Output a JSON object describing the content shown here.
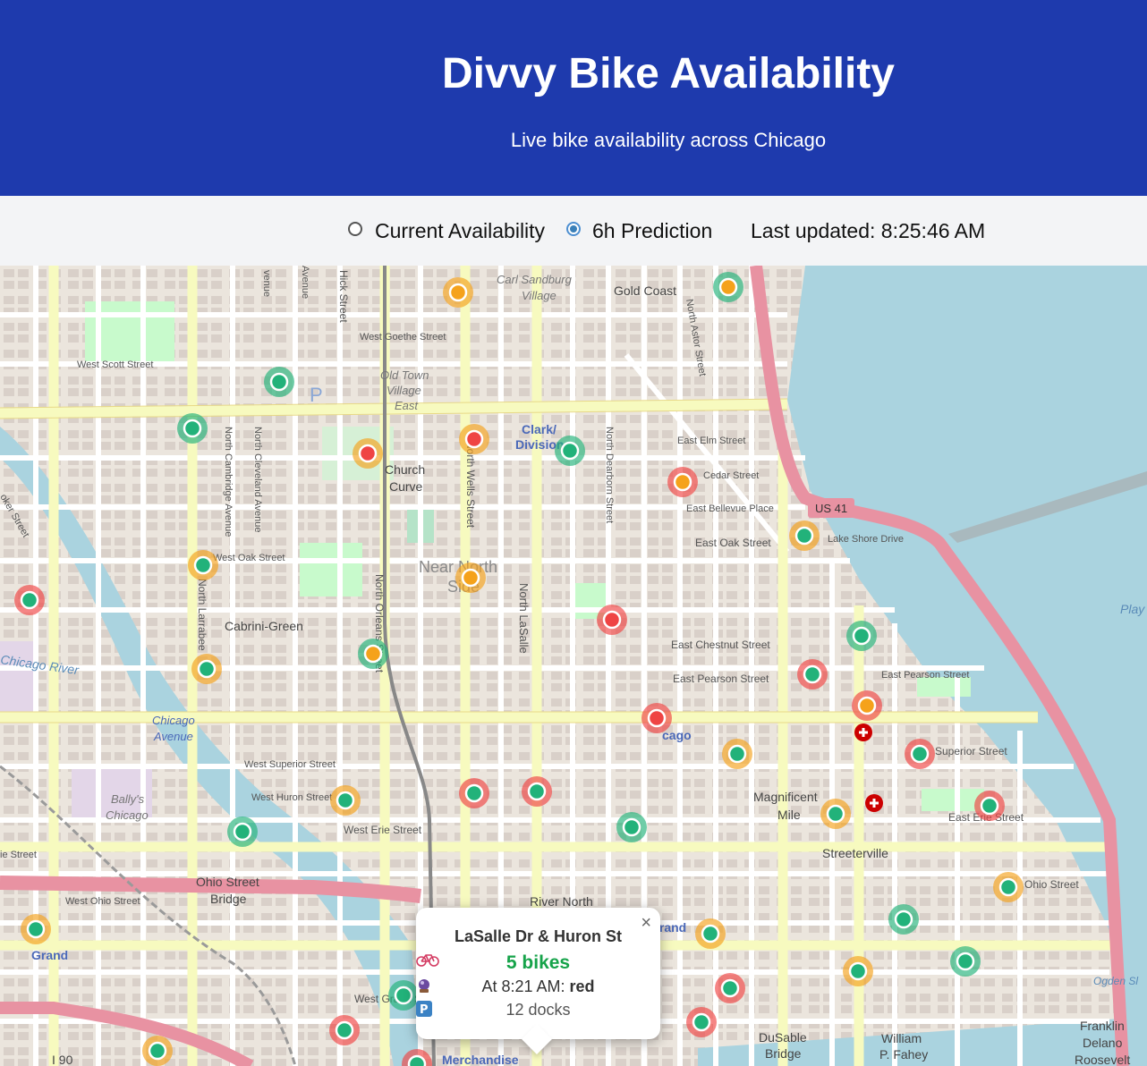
{
  "header": {
    "title": "Divvy Bike Availability",
    "subtitle": "Live bike availability across Chicago"
  },
  "controls": {
    "options": [
      {
        "label": "Current Availability",
        "selected": false
      },
      {
        "label": "6h Prediction",
        "selected": true
      }
    ],
    "last_updated": "Last updated: 8:25:46 AM"
  },
  "colors": {
    "header_bg": "#1e3aad",
    "available": "#22b27a",
    "low": "#f5a21b",
    "empty": "#ef4444",
    "water": "#aad3df",
    "highway": "#e892a2"
  },
  "popup": {
    "station": "LaSalle Dr & Huron St",
    "bikes_icon": "bicycle-icon",
    "bikes": "5 bikes",
    "prediction_icon": "crystal-ball-icon",
    "prediction_prefix": "At 8:21 AM:",
    "prediction_value": "red",
    "docks_icon": "parking-icon",
    "docks": "12 docks",
    "close": "×"
  },
  "map_labels": {
    "carl_sandburg": "Carl Sandburg",
    "village": "Village",
    "gold_coast": "Gold Coast",
    "west_goethe": "West Goethe Street",
    "west_scott": "West Scott Street",
    "old_town": "Old Town",
    "old_town_village": "Village",
    "old_town_east": "East",
    "clark_division": "Clark/",
    "clark_division2": "Division",
    "church": "Church",
    "curve": "Curve",
    "east_elm": "East Elm Street",
    "cedar": "Cedar Street",
    "bellevue": "East Bellevue Place",
    "us41": "US 41",
    "east_oak": "East Oak Street",
    "lake_shore": "Lake Shore Drive",
    "near_north": "Near North",
    "near_north2": "Side",
    "west_oak": "West Oak Street",
    "cabrini": "Cabrini-Green",
    "chicago_river": "Chicago River",
    "east_chestnut": "East Chestnut Street",
    "east_pearson": "East Pearson Street",
    "east_pearson2": "East Pearson Street",
    "chicago_avenue": "Chicago",
    "chicago_avenue2": "Avenue",
    "chicago_cta": "cago",
    "west_superior": "West Superior Street",
    "superior": "Superior Street",
    "west_huron": "West Huron Street",
    "bally1": "Bally's",
    "bally2": "Chicago",
    "west_erie": "West Erie Street",
    "magnificent1": "Magnificent",
    "magnificent2": "Mile",
    "east_erie": "East Erie Street",
    "streeterville": "Streeterville",
    "ohio_street": "Ohio Street",
    "ohio_bridge1": "Ohio Street",
    "ohio_bridge2": "Bridge",
    "west_ohio": "West Ohio Street",
    "river_north": "River North",
    "grand_left": "Grand",
    "grand_center": "Grand",
    "west_grand": "West Grand Street",
    "merchandise": "Merchandise",
    "dusable1": "DuSable",
    "dusable2": "Bridge",
    "william1": "William",
    "william2": "P. Fahey",
    "franklin1": "Franklin",
    "franklin2": "Delano",
    "franklin3": "Roosevelt",
    "ogden": "Ogden Sl",
    "i90": "I 90",
    "play": "Play",
    "ie_street": "ie Street",
    "north_wells": "North Wells Street",
    "north_dearborn": "North Dearborn Street",
    "north_astor": "North Astor Street",
    "north_cambridge": "North Cambridge Avenue",
    "north_cleveland": "North Cleveland Avenue",
    "north_larrabee": "North Larrabee",
    "north_orleans": "North Orleans Street",
    "north_lasalle": "North LaSalle",
    "hick_street": "Hick Street",
    "venue": "venue",
    "venue2": "Avenue",
    "oker_street": "oker Street"
  }
}
